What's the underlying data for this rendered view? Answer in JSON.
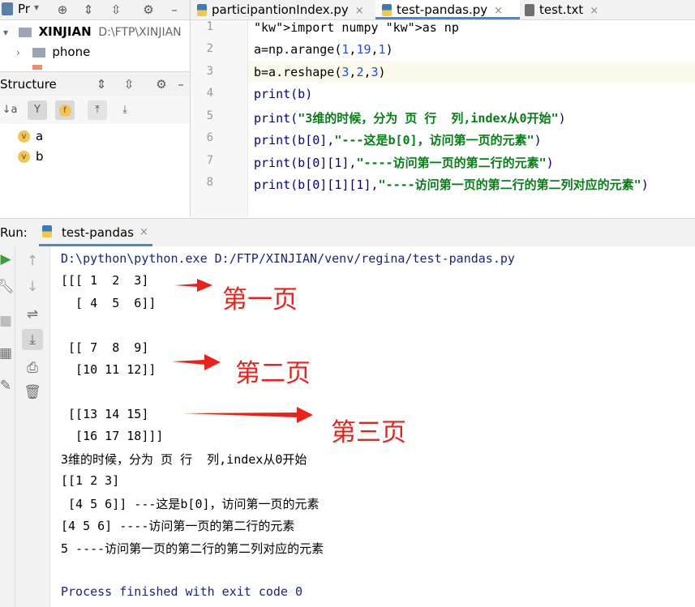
{
  "project_panel": {
    "title": "Pr",
    "root_name": "XINJIAN",
    "root_path": "D:\\FTP\\XINJIAN",
    "child_folder": "phone"
  },
  "structure_panel": {
    "title": "Structure",
    "items": [
      "a",
      "b"
    ],
    "item_badge": "v",
    "field_badge": "f"
  },
  "editor": {
    "tabs": [
      {
        "label": "participantionIndex.py",
        "active": false
      },
      {
        "label": "test-pandas.py",
        "active": true
      },
      {
        "label": "test.txt",
        "active": false
      }
    ],
    "lines": [
      {
        "n": "1",
        "code": "import numpy as np"
      },
      {
        "n": "2",
        "code": "a=np.arange(1,19,1)"
      },
      {
        "n": "3",
        "code": "b=a.reshape(3,2,3)"
      },
      {
        "n": "4",
        "code": "print(b)"
      },
      {
        "n": "5",
        "code": "print(\"3维的时候，分为 页 行  列,index从0开始\")"
      },
      {
        "n": "6",
        "code": "print(b[0],\"---这是b[0]，访问第一页的元素\")"
      },
      {
        "n": "7",
        "code": "print(b[0][1],\"----访问第一页的第二行的元素\")"
      },
      {
        "n": "8",
        "code": "print(b[0][1][1],\"----访问第一页的第二行的第二列对应的元素\")"
      }
    ]
  },
  "run_panel": {
    "label": "Run:",
    "tab": "test-pandas",
    "output": [
      "D:\\python\\python.exe D:/FTP/XINJIAN/venv/regina/test-pandas.py",
      "[[[ 1  2  3]",
      "  [ 4  5  6]]",
      "",
      " [[ 7  8  9]",
      "  [10 11 12]]",
      "",
      " [[13 14 15]",
      "  [16 17 18]]]",
      "3维的时候，分为 页 行  列,index从0开始",
      "[[1 2 3]",
      " [4 5 6]] ---这是b[0]，访问第一页的元素",
      "[4 5 6] ----访问第一页的第二行的元素",
      "5 ----访问第一页的第二行的第二列对应的元素",
      "",
      "Process finished with exit code 0"
    ]
  },
  "annotations": {
    "page1": "第一页",
    "page2": "第二页",
    "page3": "第三页",
    "color": "#e8231c"
  }
}
